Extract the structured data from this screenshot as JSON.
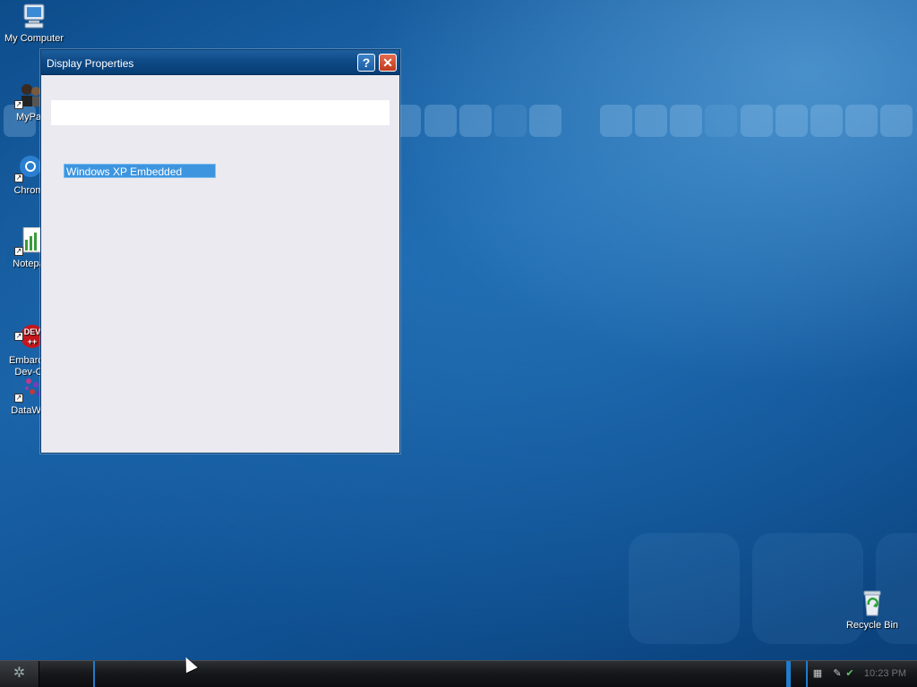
{
  "desktop": {
    "icons": [
      {
        "label": "My Computer"
      },
      {
        "label": "MyPa"
      },
      {
        "label": "Chrom"
      },
      {
        "label": "Notepa"
      },
      {
        "label": "Embarca\nDev-C"
      },
      {
        "label": "DataWe"
      },
      {
        "label": "Recycle Bin"
      }
    ]
  },
  "dialog": {
    "title": "Display Properties",
    "help_label": "?",
    "close_label": "✕",
    "selected_item": "Windows XP Embedded"
  },
  "taskbar": {
    "clock": "10:23 PM"
  },
  "colors": {
    "desktop_blue": "#1a63a8",
    "selection_blue": "#3d95e0",
    "close_red": "#c03a1c"
  }
}
